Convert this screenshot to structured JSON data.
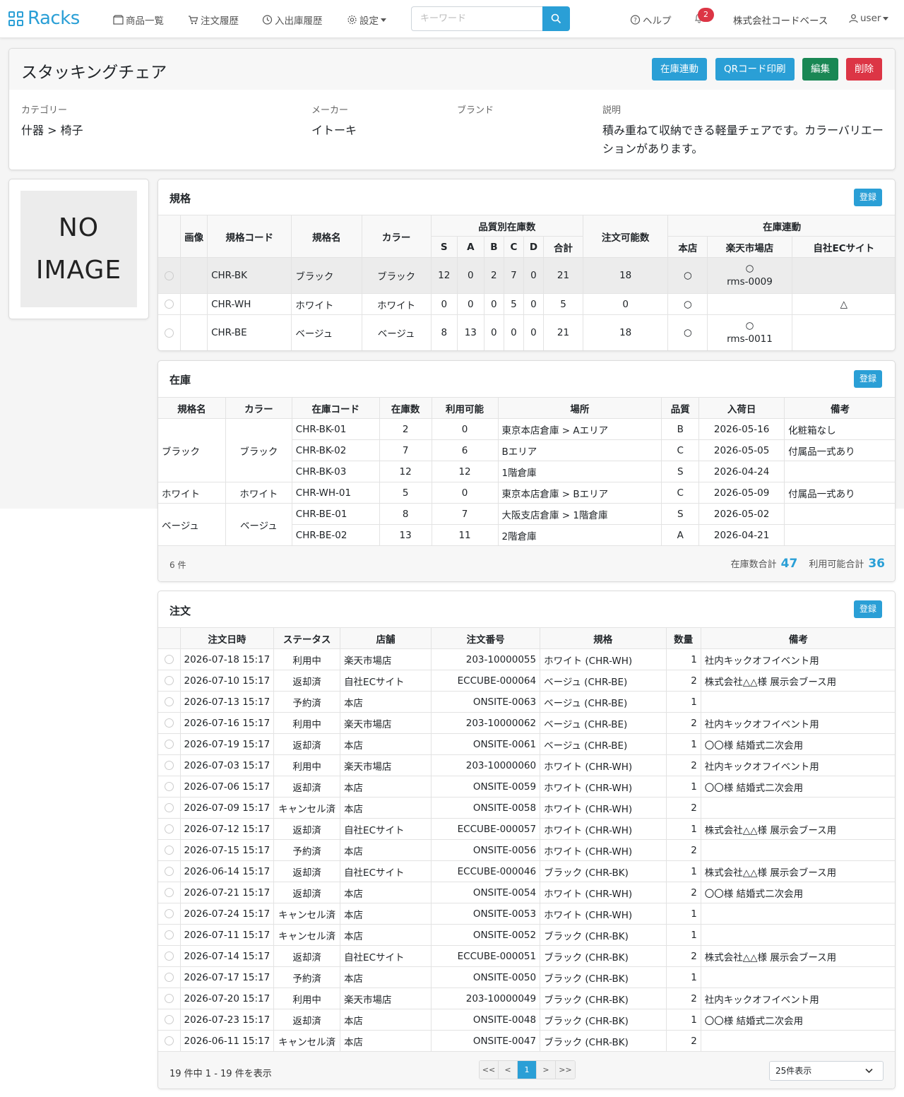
{
  "nav": {
    "brand": "Racks",
    "items": [
      "商品一覧",
      "注文履歴",
      "入出庫履歴",
      "設定"
    ],
    "search_placeholder": "キーワード",
    "help": "ヘルプ",
    "notifications": "2",
    "company": "株式会社コードベース",
    "user": "user"
  },
  "product": {
    "title": "スタッキングチェア",
    "buttons": {
      "sync": "在庫連動",
      "qr": "QRコード印刷",
      "edit": "編集",
      "delete": "削除"
    },
    "category_label": "カテゴリー",
    "category_value": "什器 > 椅子",
    "maker_label": "メーカー",
    "maker_value": "イトーキ",
    "brand_label": "ブランド",
    "brand_value": "",
    "desc_label": "説明",
    "desc_value": "積み重ねて収納できる軽量チェアです。カラーバリエーションがあります。",
    "no_image_1": "NO",
    "no_image_2": "IMAGE"
  },
  "specs": {
    "title": "規格",
    "register": "登録",
    "headers": {
      "image": "画像",
      "code": "規格コード",
      "name": "規格名",
      "color": "カラー",
      "quality_group": "品質別在庫数",
      "q": [
        "S",
        "A",
        "B",
        "C",
        "D",
        "合計"
      ],
      "orderable": "注文可能数",
      "sync_group": "在庫連動",
      "sync": [
        "本店",
        "楽天市場店",
        "自社ECサイト"
      ]
    },
    "rows": [
      {
        "code": "CHR-BK",
        "name": "ブラック",
        "color": "ブラック",
        "q": [
          "12",
          "0",
          "2",
          "7",
          "0",
          "21"
        ],
        "orderable": "18",
        "honten": "○",
        "rakuten_mark": "○",
        "rakuten_id": "rms-0009",
        "ec": ""
      },
      {
        "code": "CHR-WH",
        "name": "ホワイト",
        "color": "ホワイト",
        "q": [
          "0",
          "0",
          "0",
          "5",
          "0",
          "5"
        ],
        "orderable": "0",
        "honten": "○",
        "rakuten_mark": "",
        "rakuten_id": "",
        "ec": "△"
      },
      {
        "code": "CHR-BE",
        "name": "ベージュ",
        "color": "ベージュ",
        "q": [
          "8",
          "13",
          "0",
          "0",
          "0",
          "21"
        ],
        "orderable": "18",
        "honten": "○",
        "rakuten_mark": "○",
        "rakuten_id": "rms-0011",
        "ec": ""
      }
    ]
  },
  "stock": {
    "title": "在庫",
    "register": "登録",
    "headers": [
      "規格名",
      "カラー",
      "在庫コード",
      "在庫数",
      "利用可能",
      "場所",
      "品質",
      "入荷日",
      "備考"
    ],
    "groups": [
      {
        "name": "ブラック",
        "color": "ブラック",
        "rows": [
          {
            "code": "CHR-BK-01",
            "qty": "2",
            "avail": "0",
            "place": "東京本店倉庫 > Aエリア",
            "quality": "B",
            "date": "2026-05-16",
            "note": "化粧箱なし"
          },
          {
            "code": "CHR-BK-02",
            "qty": "7",
            "avail": "6",
            "place": "Bエリア",
            "quality": "C",
            "date": "2026-05-05",
            "note": "付属品一式あり"
          },
          {
            "code": "CHR-BK-03",
            "qty": "12",
            "avail": "12",
            "place": "1階倉庫",
            "quality": "S",
            "date": "2026-04-24",
            "note": ""
          }
        ]
      },
      {
        "name": "ホワイト",
        "color": "ホワイト",
        "rows": [
          {
            "code": "CHR-WH-01",
            "qty": "5",
            "avail": "0",
            "place": "東京本店倉庫 > Bエリア",
            "quality": "C",
            "date": "2026-05-09",
            "note": "付属品一式あり"
          }
        ]
      },
      {
        "name": "ベージュ",
        "color": "ベージュ",
        "rows": [
          {
            "code": "CHR-BE-01",
            "qty": "8",
            "avail": "7",
            "place": "大阪支店倉庫 > 1階倉庫",
            "quality": "S",
            "date": "2026-05-02",
            "note": ""
          },
          {
            "code": "CHR-BE-02",
            "qty": "13",
            "avail": "11",
            "place": "2階倉庫",
            "quality": "A",
            "date": "2026-04-21",
            "note": ""
          }
        ]
      }
    ],
    "count": "6 件",
    "total_qty_label": "在庫数合計",
    "total_qty": "47",
    "total_avail_label": "利用可能合計",
    "total_avail": "36"
  },
  "orders": {
    "title": "注文",
    "register": "登録",
    "headers": [
      "注文日時",
      "ステータス",
      "店舗",
      "注文番号",
      "規格",
      "数量",
      "備考"
    ],
    "rows": [
      [
        "2026-07-18 15:17",
        "利用中",
        "楽天市場店",
        "203-10000055",
        "ホワイト (CHR-WH)",
        "1",
        "社内キックオフイベント用"
      ],
      [
        "2026-07-10 15:17",
        "返却済",
        "自社ECサイト",
        "ECCUBE-000064",
        "ベージュ (CHR-BE)",
        "2",
        "株式会社△△様 展示会ブース用"
      ],
      [
        "2026-07-13 15:17",
        "予約済",
        "本店",
        "ONSITE-0063",
        "ベージュ (CHR-BE)",
        "1",
        ""
      ],
      [
        "2026-07-16 15:17",
        "利用中",
        "楽天市場店",
        "203-10000062",
        "ベージュ (CHR-BE)",
        "2",
        "社内キックオフイベント用"
      ],
      [
        "2026-07-19 15:17",
        "返却済",
        "本店",
        "ONSITE-0061",
        "ベージュ (CHR-BE)",
        "1",
        "〇〇様 結婚式二次会用"
      ],
      [
        "2026-07-03 15:17",
        "利用中",
        "楽天市場店",
        "203-10000060",
        "ホワイト (CHR-WH)",
        "2",
        "社内キックオフイベント用"
      ],
      [
        "2026-07-06 15:17",
        "返却済",
        "本店",
        "ONSITE-0059",
        "ホワイト (CHR-WH)",
        "1",
        "〇〇様 結婚式二次会用"
      ],
      [
        "2026-07-09 15:17",
        "キャンセル済",
        "本店",
        "ONSITE-0058",
        "ホワイト (CHR-WH)",
        "2",
        ""
      ],
      [
        "2026-07-12 15:17",
        "返却済",
        "自社ECサイト",
        "ECCUBE-000057",
        "ホワイト (CHR-WH)",
        "1",
        "株式会社△△様 展示会ブース用"
      ],
      [
        "2026-07-15 15:17",
        "予約済",
        "本店",
        "ONSITE-0056",
        "ホワイト (CHR-WH)",
        "2",
        ""
      ],
      [
        "2026-06-14 15:17",
        "返却済",
        "自社ECサイト",
        "ECCUBE-000046",
        "ブラック (CHR-BK)",
        "1",
        "株式会社△△様 展示会ブース用"
      ],
      [
        "2026-07-21 15:17",
        "返却済",
        "本店",
        "ONSITE-0054",
        "ホワイト (CHR-WH)",
        "2",
        "〇〇様 結婚式二次会用"
      ],
      [
        "2026-07-24 15:17",
        "キャンセル済",
        "本店",
        "ONSITE-0053",
        "ホワイト (CHR-WH)",
        "1",
        ""
      ],
      [
        "2026-07-11 15:17",
        "キャンセル済",
        "本店",
        "ONSITE-0052",
        "ブラック (CHR-BK)",
        "1",
        ""
      ],
      [
        "2026-07-14 15:17",
        "返却済",
        "自社ECサイト",
        "ECCUBE-000051",
        "ブラック (CHR-BK)",
        "2",
        "株式会社△△様 展示会ブース用"
      ],
      [
        "2026-07-17 15:17",
        "予約済",
        "本店",
        "ONSITE-0050",
        "ブラック (CHR-BK)",
        "1",
        ""
      ],
      [
        "2026-07-20 15:17",
        "利用中",
        "楽天市場店",
        "203-10000049",
        "ブラック (CHR-BK)",
        "2",
        "社内キックオフイベント用"
      ],
      [
        "2026-07-23 15:17",
        "返却済",
        "本店",
        "ONSITE-0048",
        "ブラック (CHR-BK)",
        "1",
        "〇〇様 結婚式二次会用"
      ],
      [
        "2026-06-11 15:17",
        "キャンセル済",
        "本店",
        "ONSITE-0047",
        "ブラック (CHR-BK)",
        "2",
        ""
      ]
    ],
    "summary": "19 件中 1 - 19 件を表示",
    "pager": [
      "<<",
      "<",
      "1",
      ">",
      ">>"
    ],
    "per_page": "25件表示"
  }
}
